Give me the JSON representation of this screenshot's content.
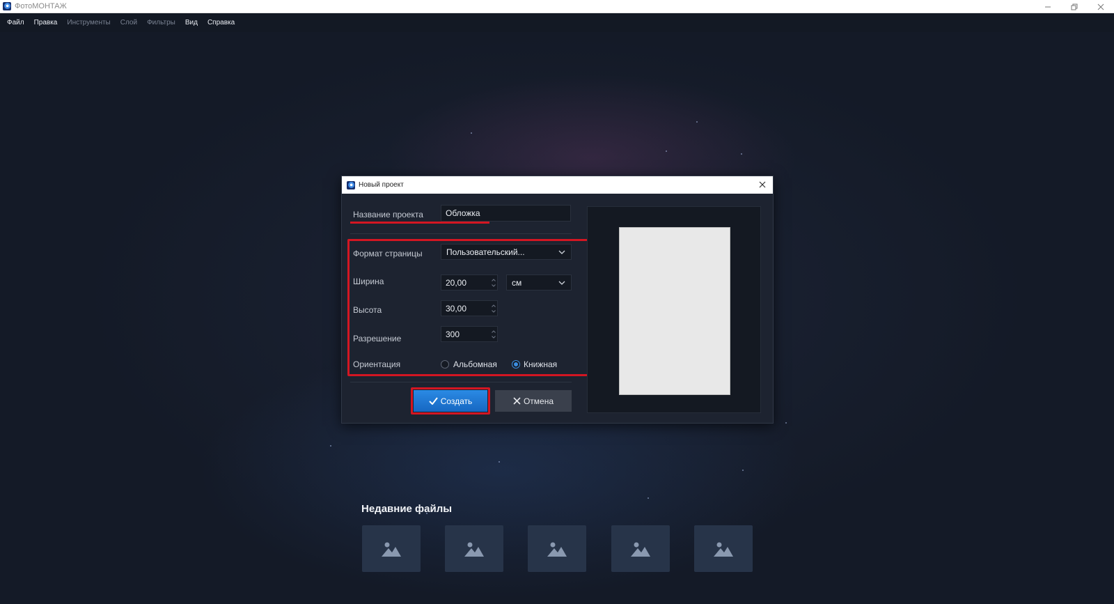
{
  "app": {
    "title": "ФотоМОНТАЖ"
  },
  "menu": [
    {
      "label": "Файл",
      "enabled": true
    },
    {
      "label": "Правка",
      "enabled": true
    },
    {
      "label": "Инструменты",
      "enabled": false
    },
    {
      "label": "Слой",
      "enabled": false
    },
    {
      "label": "Фильтры",
      "enabled": false
    },
    {
      "label": "Вид",
      "enabled": true
    },
    {
      "label": "Справка",
      "enabled": true
    }
  ],
  "dialog": {
    "title": "Новый проект",
    "project_name": {
      "label": "Название проекта",
      "value": "Обложка"
    },
    "page_format": {
      "label": "Формат страницы",
      "value": "Пользовательский..."
    },
    "width": {
      "label": "Ширина",
      "value": "20,00",
      "unit": "см"
    },
    "height": {
      "label": "Высота",
      "value": "30,00"
    },
    "resolution": {
      "label": "Разрешение",
      "value": "300"
    },
    "orientation": {
      "label": "Ориентация",
      "options": [
        {
          "label": "Альбомная",
          "checked": false
        },
        {
          "label": "Книжная",
          "checked": true
        }
      ]
    },
    "create_label": "Создать",
    "cancel_label": "Отмена"
  },
  "recent": {
    "title": "Недавние файлы",
    "thumbnails": [
      "image-icon",
      "image-icon",
      "image-icon",
      "image-icon",
      "image-icon"
    ]
  },
  "colors": {
    "accent": "#1f7ad6",
    "highlight": "#d31622",
    "background": "#151c2a"
  }
}
